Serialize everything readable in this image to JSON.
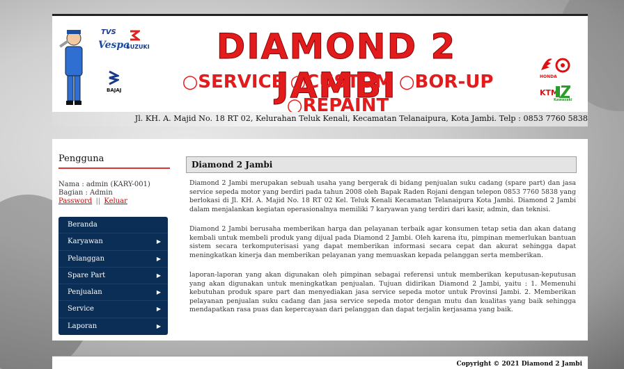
{
  "header": {
    "title": "DIAMOND 2 JAMBI",
    "services": "○SERVICE ○CUSTOM ○BOR-UP ○REPAINT",
    "address": "Jl. KH. A. Majid No. 18 RT 02, Kelurahan Teluk Kenali, Kecamatan Telanaipura, Kota Jambi. Telp : 0853 7760 5838",
    "brands_left": [
      "TVS",
      "Vespa",
      "SUZUKI",
      "BAJAJ"
    ],
    "brands_right": [
      "HONDA",
      "KTM",
      "Kawasaki"
    ]
  },
  "sidebar": {
    "title": "Pengguna",
    "name_line": "Nama : admin (KARY-001)",
    "role_line": "Bagian : Admin",
    "password_link": "Password",
    "separator": "||",
    "logout_link": "Keluar",
    "menu": [
      {
        "label": "Beranda",
        "has_sub": false
      },
      {
        "label": "Karyawan",
        "has_sub": true
      },
      {
        "label": "Pelanggan",
        "has_sub": true
      },
      {
        "label": "Spare Part",
        "has_sub": true
      },
      {
        "label": "Penjualan",
        "has_sub": true
      },
      {
        "label": "Service",
        "has_sub": true
      },
      {
        "label": "Laporan",
        "has_sub": true
      }
    ]
  },
  "main": {
    "title": "Diamond 2 Jambi",
    "paragraphs": [
      "Diamond 2 Jambi merupakan sebuah usaha yang bergerak di bidang penjualan suku cadang (spare part) dan jasa service sepeda motor yang berdiri pada tahun 2008 oleh Bapak Raden Rojani dengan telepon 0853 7760 5838 yang berlokasi di Jl. KH. A. Majid No. 18 RT 02 Kel. Teluk Kenali Kecamatan Telanaipura Kota Jambi. Diamond 2 Jambi dalam menjalankan kegiatan operasionalnya memiliki 7 karyawan yang terdiri dari kasir, admin, dan teknisi.",
      "Diamond 2 Jambi berusaha memberikan harga dan pelayanan terbaik agar konsumen tetap setia dan akan datang kembali untuk membeli produk yang dijual pada Diamond 2 Jambi. Oleh karena itu, pimpinan memerlukan bantuan sistem secara terkomputerisasi yang dapat memberikan informasi secara cepat dan akurat sehingga dapat meningkatkan kinerja dan memberikan pelayanan yang memuaskan kepada pelanggan serta memberikan.",
      "laporan-laporan yang akan digunakan oleh pimpinan sebagai referensi untuk memberikan keputusan-keputusan yang akan digunakan untuk meningkatkan penjualan. Tujuan didirikan Diamond 2 Jambi, yaitu : 1. Memenuhi kebutuhan produk spare part dan menyediakan jasa service sepeda motor untuk Provinsi Jambi. 2. Memberikan pelayanan penjualan suku cadang dan jasa service sepeda motor dengan mutu dan kualitas yang baik sehingga mendapatkan rasa puas dan kepercayaan dari pelanggan dan dapat terjalin kerjasama yang baik."
    ]
  },
  "footer": {
    "copyright": "Copyright © 2021 Diamond 2 Jambi"
  },
  "colors": {
    "accent_red": "#e21c1c",
    "menu_bg": "#0b2e57"
  }
}
